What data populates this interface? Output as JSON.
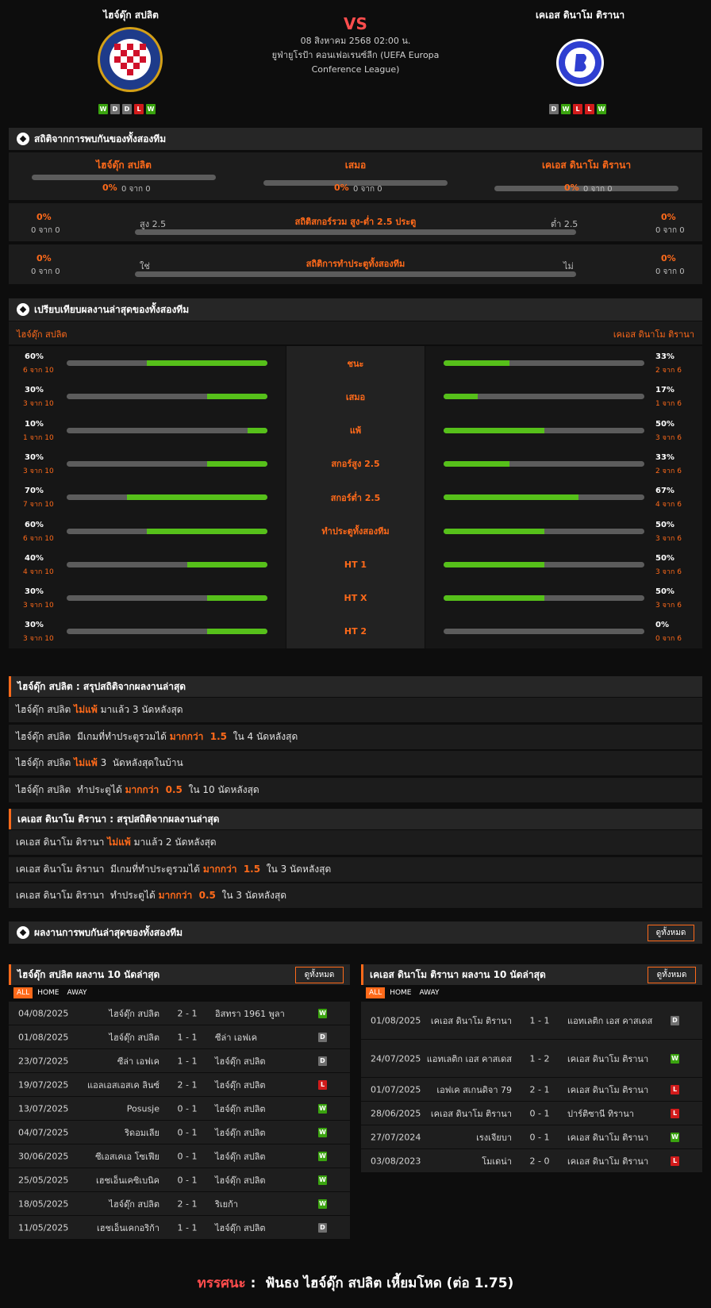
{
  "header": {
    "home_team": "ไฮจ์ดุ๊ก สปลิต",
    "away_team": "เคเอส ดินาโม ติรานา",
    "vs": "VS",
    "date": "08 สิงหาคม 2568 02:00 น.",
    "competition_line1": "ยูฟ่ายูโรป้า คอนเฟอเรนซ์ลีก (UEFA Europa",
    "competition_line2": "Conference League)",
    "home_form": [
      "W",
      "D",
      "D",
      "L",
      "W"
    ],
    "away_form": [
      "D",
      "W",
      "L",
      "L",
      "W"
    ]
  },
  "h2h": {
    "title": "สถิติจากการพบกันของทั้งสองทีม",
    "cols": [
      {
        "label": "ไฮจ์ดุ๊ก สปลิต",
        "pct": "0%",
        "count": "0 จาก 0"
      },
      {
        "label": "เสมอ",
        "pct": "0%",
        "count": "0 จาก 0"
      },
      {
        "label": "เคเอส ดินาโม ติรานา",
        "pct": "0%",
        "count": "0 จาก 0"
      }
    ],
    "goals": {
      "title": "สถิติสกอร์รวม สูง-ต่ำ 2.5 ประตู",
      "left_label": "สูง 2.5",
      "right_label": "ต่ำ 2.5",
      "left_pct": "0%",
      "left_count": "0 จาก 0",
      "right_pct": "0%",
      "right_count": "0 จาก 0"
    },
    "btts": {
      "title": "สถิติการทำประตูทั้งสองทีม",
      "left_label": "ใช่",
      "right_label": "ไม่",
      "left_pct": "0%",
      "left_count": "0 จาก 0",
      "right_pct": "0%",
      "right_count": "0 จาก 0"
    }
  },
  "compare": {
    "title": "เปรียบเทียบผลงานล่าสุดของทั้งสองทีม",
    "home_label": "ไฮจ์ดุ๊ก สปลิต",
    "away_label": "เคเอส ดินาโม ติรานา",
    "rows": [
      {
        "label": "ชนะ",
        "home_pct": "60%",
        "home_count": "6 จาก 10",
        "home_val": 0.6,
        "away_pct": "33%",
        "away_count": "2 จาก 6",
        "away_val": 0.33
      },
      {
        "label": "เสมอ",
        "home_pct": "30%",
        "home_count": "3 จาก 10",
        "home_val": 0.3,
        "away_pct": "17%",
        "away_count": "1 จาก 6",
        "away_val": 0.17
      },
      {
        "label": "แพ้",
        "home_pct": "10%",
        "home_count": "1 จาก 10",
        "home_val": 0.1,
        "away_pct": "50%",
        "away_count": "3 จาก 6",
        "away_val": 0.5
      },
      {
        "label": "สกอร์สูง 2.5",
        "home_pct": "30%",
        "home_count": "3 จาก 10",
        "home_val": 0.3,
        "away_pct": "33%",
        "away_count": "2 จาก 6",
        "away_val": 0.33
      },
      {
        "label": "สกอร์ต่ำ 2.5",
        "home_pct": "70%",
        "home_count": "7 จาก 10",
        "home_val": 0.7,
        "away_pct": "67%",
        "away_count": "4 จาก 6",
        "away_val": 0.67
      },
      {
        "label": "ทำประตูทั้งสองทีม",
        "home_pct": "60%",
        "home_count": "6 จาก 10",
        "home_val": 0.6,
        "away_pct": "50%",
        "away_count": "3 จาก 6",
        "away_val": 0.5
      },
      {
        "label": "HT 1",
        "home_pct": "40%",
        "home_count": "4 จาก 10",
        "home_val": 0.4,
        "away_pct": "50%",
        "away_count": "3 จาก 6",
        "away_val": 0.5
      },
      {
        "label": "HT X",
        "home_pct": "30%",
        "home_count": "3 จาก 10",
        "home_val": 0.3,
        "away_pct": "50%",
        "away_count": "3 จาก 6",
        "away_val": 0.5
      },
      {
        "label": "HT 2",
        "home_pct": "30%",
        "home_count": "3 จาก 10",
        "home_val": 0.3,
        "away_pct": "0%",
        "away_count": "0 จาก 6",
        "away_val": 0
      }
    ]
  },
  "home_summary": {
    "title": "ไฮจ์ดุ๊ก สปลิต : สรุปสถิติจากผลงานล่าสุด",
    "lines": [
      {
        "pre": "ไฮจ์ดุ๊ก สปลิต ",
        "hl": "ไม่แพ้",
        "post": " มาแล้ว 3 นัดหลังสุด"
      },
      {
        "pre": "ไฮจ์ดุ๊ก สปลิต  มีเกมที่ทำประตูรวมได้ ",
        "hl": "มากกว่า  1.5",
        "post": "  ใน 4 นัดหลังสุด"
      },
      {
        "pre": "ไฮจ์ดุ๊ก สปลิต ",
        "hl": "ไม่แพ้",
        "post": " 3  นัดหลังสุดในบ้าน"
      },
      {
        "pre": "ไฮจ์ดุ๊ก สปลิต  ทำประตูได้ ",
        "hl": "มากกว่า  0.5",
        "post": "  ใน 10 นัดหลังสุด"
      }
    ]
  },
  "away_summary": {
    "title": "เคเอส ดินาโม ติรานา : สรุปสถิติจากผลงานล่าสุด",
    "lines": [
      {
        "pre": "เคเอส ดินาโม ติรานา ",
        "hl": "ไม่แพ้",
        "post": " มาแล้ว 2 นัดหลังสุด"
      },
      {
        "pre": "เคเอส ดินาโม ติรานา  มีเกมที่ทำประตูรวมได้ ",
        "hl": "มากกว่า  1.5",
        "post": "  ใน 3 นัดหลังสุด"
      },
      {
        "pre": "เคเอส ดินาโม ติรานา  ทำประตูได้ ",
        "hl": "มากกว่า  0.5",
        "post": "  ใน 3 นัดหลังสุด"
      }
    ]
  },
  "recent": {
    "title": "ผลงานการพบกันล่าสุดของทั้งสองทีม",
    "view_all": "ดูทั้งหมด",
    "tabs": [
      "ALL",
      "HOME",
      "AWAY"
    ],
    "home_title": "ไฮจ์ดุ๊ก สปลิต ผลงาน 10 นัดล่าสุด",
    "away_title": "เคเอส ดินาโม ติรานา ผลงาน 10 นัดล่าสุด",
    "home_matches": [
      {
        "date": "04/08/2025",
        "home": "ไฮจ์ดุ๊ก สปลิต",
        "score": "2 - 1",
        "away": "อิสทรา 1961 พูลา",
        "res": "W"
      },
      {
        "date": "01/08/2025",
        "home": "ไฮจ์ดุ๊ก สปลิต",
        "score": "1 - 1",
        "away": "ซีล่า เอฟเค",
        "res": "D"
      },
      {
        "date": "23/07/2025",
        "home": "ซีล่า เอฟเค",
        "score": "1 - 1",
        "away": "ไฮจ์ดุ๊ก สปลิต",
        "res": "D"
      },
      {
        "date": "19/07/2025",
        "home": "แอลเอสเอสเค ลินซ์",
        "score": "2 - 1",
        "away": "ไฮจ์ดุ๊ก สปลิต",
        "res": "L"
      },
      {
        "date": "13/07/2025",
        "home": "Posusje",
        "score": "0 - 1",
        "away": "ไฮจ์ดุ๊ก สปลิต",
        "res": "W"
      },
      {
        "date": "04/07/2025",
        "home": "ริดอมเลีย",
        "score": "0 - 1",
        "away": "ไฮจ์ดุ๊ก สปลิต",
        "res": "W"
      },
      {
        "date": "30/06/2025",
        "home": "ซีเอสเคเอ โซเฟีย",
        "score": "0 - 1",
        "away": "ไฮจ์ดุ๊ก สปลิต",
        "res": "W"
      },
      {
        "date": "25/05/2025",
        "home": "เฮชเอ็นเคซิเบนิค",
        "score": "0 - 1",
        "away": "ไฮจ์ดุ๊ก สปลิต",
        "res": "W"
      },
      {
        "date": "18/05/2025",
        "home": "ไฮจ์ดุ๊ก สปลิต",
        "score": "2 - 1",
        "away": "ริเยก้า",
        "res": "W"
      },
      {
        "date": "11/05/2025",
        "home": "เฮชเอ็นเคกอริก้า",
        "score": "1 - 1",
        "away": "ไฮจ์ดุ๊ก สปลิต",
        "res": "D"
      }
    ],
    "away_matches": [
      {
        "date": "01/08/2025",
        "home": "เคเอส ดินาโม ติรานา",
        "score": "1 - 1",
        "away": "แอทเลติก เอส คาสเดส",
        "res": "D"
      },
      {
        "date": "24/07/2025",
        "home": "แอทเลติก เอส คาสเดส",
        "score": "1 - 2",
        "away": "เคเอส ดินาโม ติรานา",
        "res": "W"
      },
      {
        "date": "01/07/2025",
        "home": "เอฟเค สเกนดิจา 79",
        "score": "2 - 1",
        "away": "เคเอส ดินาโม ติรานา",
        "res": "L"
      },
      {
        "date": "28/06/2025",
        "home": "เคเอส ดินาโม ติรานา",
        "score": "0 - 1",
        "away": "ปาร์ติซานี ทิรานา",
        "res": "L"
      },
      {
        "date": "27/07/2024",
        "home": "เรงเจียบา",
        "score": "0 - 1",
        "away": "เคเอส ดินาโม ติรานา",
        "res": "W"
      },
      {
        "date": "03/08/2023",
        "home": "โมเดน่า",
        "score": "2 - 0",
        "away": "เคเอส ดินาโม ติรานา",
        "res": "L"
      }
    ]
  },
  "verdict": {
    "label": "ทรรศนะ",
    "sep": " :  ",
    "text": "ฟันธง ไฮจ์ดุ๊ก สปลิต เหี้ยมโหด (ต่อ 1.75)"
  },
  "colors": {
    "accent": "#ff6a1a",
    "win": "#3aa30f",
    "draw": "#6f6f6f",
    "loss": "#d21b1b",
    "bar_fill": "#56c01a"
  }
}
